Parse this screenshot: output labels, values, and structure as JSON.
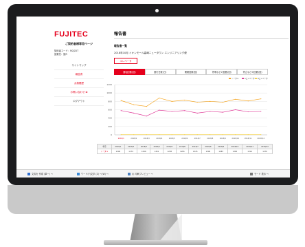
{
  "colors": {
    "brand": "#e5001c",
    "series_total": "#f5a623",
    "series_a": "#e0409a",
    "series_b": "#f3d24c"
  },
  "sidebar": {
    "logo": "FUJITEC",
    "title": "ご契約者様専用ページ",
    "user_lines": [
      "契約者コード：R0J2DT",
      "設置先：施R"
    ],
    "items": [
      {
        "label": "サイトマップ",
        "style": "normal"
      },
      {
        "label": "報告書",
        "style": "active"
      },
      {
        "label": "点検履歴",
        "style": "red"
      },
      {
        "label": "お問い合わせ ⊠",
        "style": "red"
      },
      {
        "label": "ログアウト",
        "style": "normal"
      }
    ]
  },
  "main": {
    "heading": "報告書",
    "subheading": "報告書一覧",
    "description": "2018年10月 イオンモール高崎ニュータウン エンジニアリング便",
    "small_tab": "エレベータ",
    "tabs": [
      {
        "label": "運転回数(回)",
        "active": true
      },
      {
        "label": "運行日数(日)",
        "active": false
      },
      {
        "label": "開閉回数(回)",
        "active": false
      },
      {
        "label": "停電などの回数(回)",
        "active": false
      },
      {
        "label": "停止などの回数(回)",
        "active": false
      }
    ]
  },
  "chart_data": {
    "type": "line",
    "legend": [
      "トータル",
      "Aエレベータ",
      "Bエレベータ"
    ],
    "legend_position": "top-right",
    "yticks": [
      "1200",
      "1000",
      "800",
      "600",
      "400",
      "200",
      "0"
    ],
    "ylim": [
      0,
      1200
    ],
    "grid": true,
    "x": [
      "2018/1",
      "2018/2",
      "2018/3",
      "2018/4",
      "2018/5",
      "2018/6",
      "2018/7",
      "2018/8",
      "2018/9",
      "2018/10",
      "2018/11",
      "2018/12"
    ],
    "first_label_highlight": "2018/1",
    "series": [
      {
        "name": "トータル",
        "color": "#f5a623",
        "values": [
          820,
          720,
          680,
          880,
          800,
          830,
          780,
          800,
          780,
          850,
          810,
          860
        ]
      },
      {
        "name": "Aエレベータ",
        "color": "#e0409a",
        "values": [
          580,
          520,
          450,
          590,
          560,
          580,
          520,
          560,
          540,
          600,
          550,
          560
        ]
      },
      {
        "name": "Bエレベータ",
        "color": "#f3d24c",
        "values": [
          5,
          5,
          5,
          5,
          5,
          5,
          5,
          5,
          5,
          5,
          5,
          5
        ]
      }
    ]
  },
  "table": {
    "header": [
      "年月",
      "2018/1",
      "2018/2",
      "2018/3",
      "2018/4",
      "2018/5",
      "2018/6",
      "2018/7",
      "2018/8",
      "2018/9",
      "2018/10",
      "2018/11",
      "2018/12"
    ],
    "row": [
      "トータル",
      "1300",
      "1174",
      "1056",
      "1451",
      "1258",
      "1281",
      "1325",
      "1390",
      "1283",
      "1395",
      "1314",
      "1270"
    ]
  },
  "taskbar": [
    {
      "icon": "flag-icon",
      "label": "文書を 作成 (単一) ～"
    },
    {
      "icon": "printer-icon",
      "label": "ワード(Y)文字 (Z) ～(W) ～"
    },
    {
      "icon": "document-icon",
      "label": "(I) 印刷プレビュー ～"
    },
    {
      "icon": "zoom-icon",
      "label": "モード 表示 ～"
    }
  ]
}
